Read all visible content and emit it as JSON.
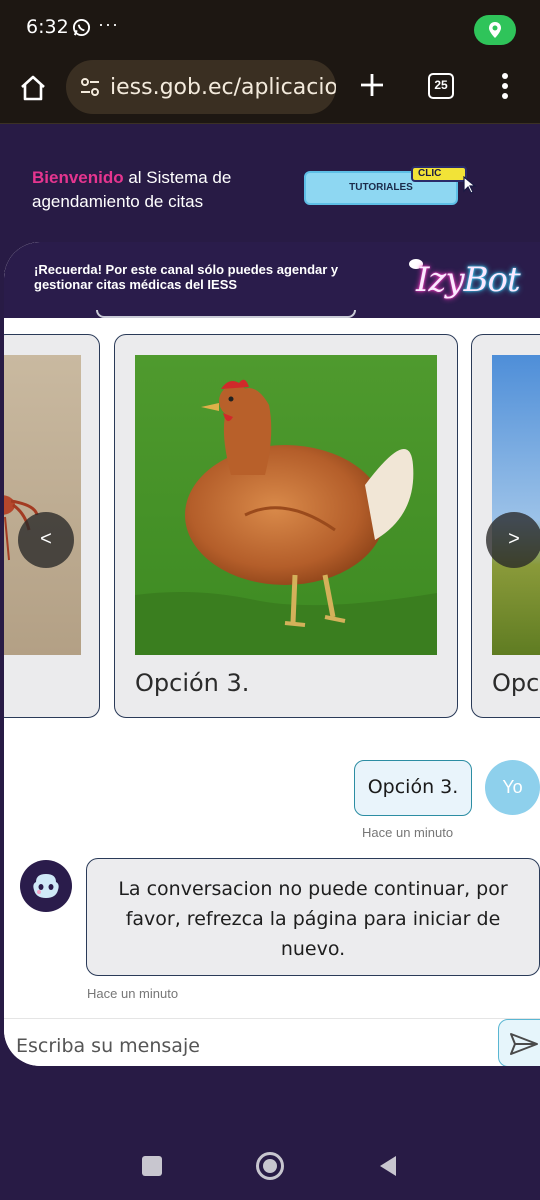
{
  "status_bar": {
    "time": "6:32",
    "more_indicator": "···"
  },
  "browser": {
    "url": "iess.gob.ec/aplicacion",
    "tab_count": "25"
  },
  "header": {
    "welcome_highlight": "Bienvenido",
    "welcome_rest": " al Sistema de agendamiento de citas",
    "tutorial_button": "TUTORIALES",
    "clic_badge": "CLIC"
  },
  "chat": {
    "notice": "¡Recuerda! Por este canal sólo puedes agendar y gestionar citas médicas del IESS",
    "brand": {
      "part1": "Izy",
      "part2": "Bot"
    },
    "carousel": {
      "prev_label": "<",
      "next_label": ">",
      "cards": [
        {
          "label": ""
        },
        {
          "label": "Opción 3."
        },
        {
          "label": "Opc"
        }
      ]
    },
    "messages": [
      {
        "from": "user",
        "text": "Opción 3.",
        "avatar": "Yo",
        "time": "Hace un minuto"
      },
      {
        "from": "bot",
        "text": "La conversacion no puede continuar, por favor, refrezca la página para iniciar de nuevo.",
        "time": "Hace un minuto"
      }
    ],
    "input": {
      "placeholder": "Escriba su mensaje"
    }
  },
  "colors": {
    "page_bg": "#281b45",
    "accent_pink": "#e5358f",
    "user_avatar": "#8ed0ec",
    "status_location": "#2fc45a"
  }
}
